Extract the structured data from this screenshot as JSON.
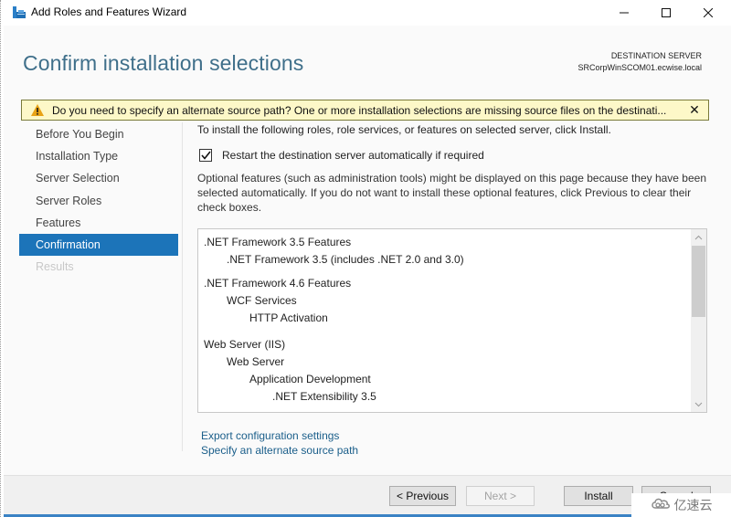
{
  "window": {
    "title": "Add Roles and Features Wizard",
    "controls": {
      "minimize": "minimize",
      "maximize": "maximize",
      "close": "close"
    }
  },
  "header": {
    "page_title": "Confirm installation selections",
    "destination_label": "DESTINATION SERVER",
    "destination_server": "SRCorpWinSCOM01.ecwise.local"
  },
  "warning": {
    "icon": "warning-triangle-icon",
    "text": "Do you need to specify an alternate source path? One or more installation selections are missing source files on the destinati...",
    "close_glyph": "✕"
  },
  "sidebar": {
    "items": [
      {
        "label": "Before You Begin",
        "state": "normal"
      },
      {
        "label": "Installation Type",
        "state": "normal"
      },
      {
        "label": "Server Selection",
        "state": "normal"
      },
      {
        "label": "Server Roles",
        "state": "normal"
      },
      {
        "label": "Features",
        "state": "normal"
      },
      {
        "label": "Confirmation",
        "state": "active"
      },
      {
        "label": "Results",
        "state": "disabled"
      }
    ]
  },
  "content": {
    "intro": "To install the following roles, role services, or features on selected server, click Install.",
    "restart_checkbox": {
      "label": "Restart the destination server automatically if required",
      "checked": true
    },
    "optional_text": "Optional features (such as administration tools) might be displayed on this page because they have been selected automatically. If you do not want to install these optional features, click Previous to clear their check boxes.",
    "selections": [
      {
        "text": ".NET Framework 3.5 Features",
        "level": 0
      },
      {
        "text": ".NET Framework 3.5 (includes .NET 2.0 and 3.0)",
        "level": 1
      },
      {
        "text": ".NET Framework 4.6 Features",
        "level": 0
      },
      {
        "text": "WCF Services",
        "level": 1
      },
      {
        "text": "HTTP Activation",
        "level": 2
      },
      {
        "text": "Web Server (IIS)",
        "level": 0
      },
      {
        "text": "Web Server",
        "level": 1
      },
      {
        "text": "Application Development",
        "level": 2
      },
      {
        "text": ".NET Extensibility 3.5",
        "level": 3
      }
    ],
    "links": {
      "export": "Export configuration settings",
      "alternate_source": "Specify an alternate source path"
    }
  },
  "footer": {
    "previous": "< Previous",
    "next": "Next >",
    "install": "Install",
    "cancel": "Cancel"
  },
  "watermark": {
    "text": "亿速云"
  },
  "colors": {
    "title_accent": "#3f6f8a",
    "active_nav": "#1c74b9",
    "warning_bg": "#fdf8c8",
    "link": "#1a5e8a"
  }
}
